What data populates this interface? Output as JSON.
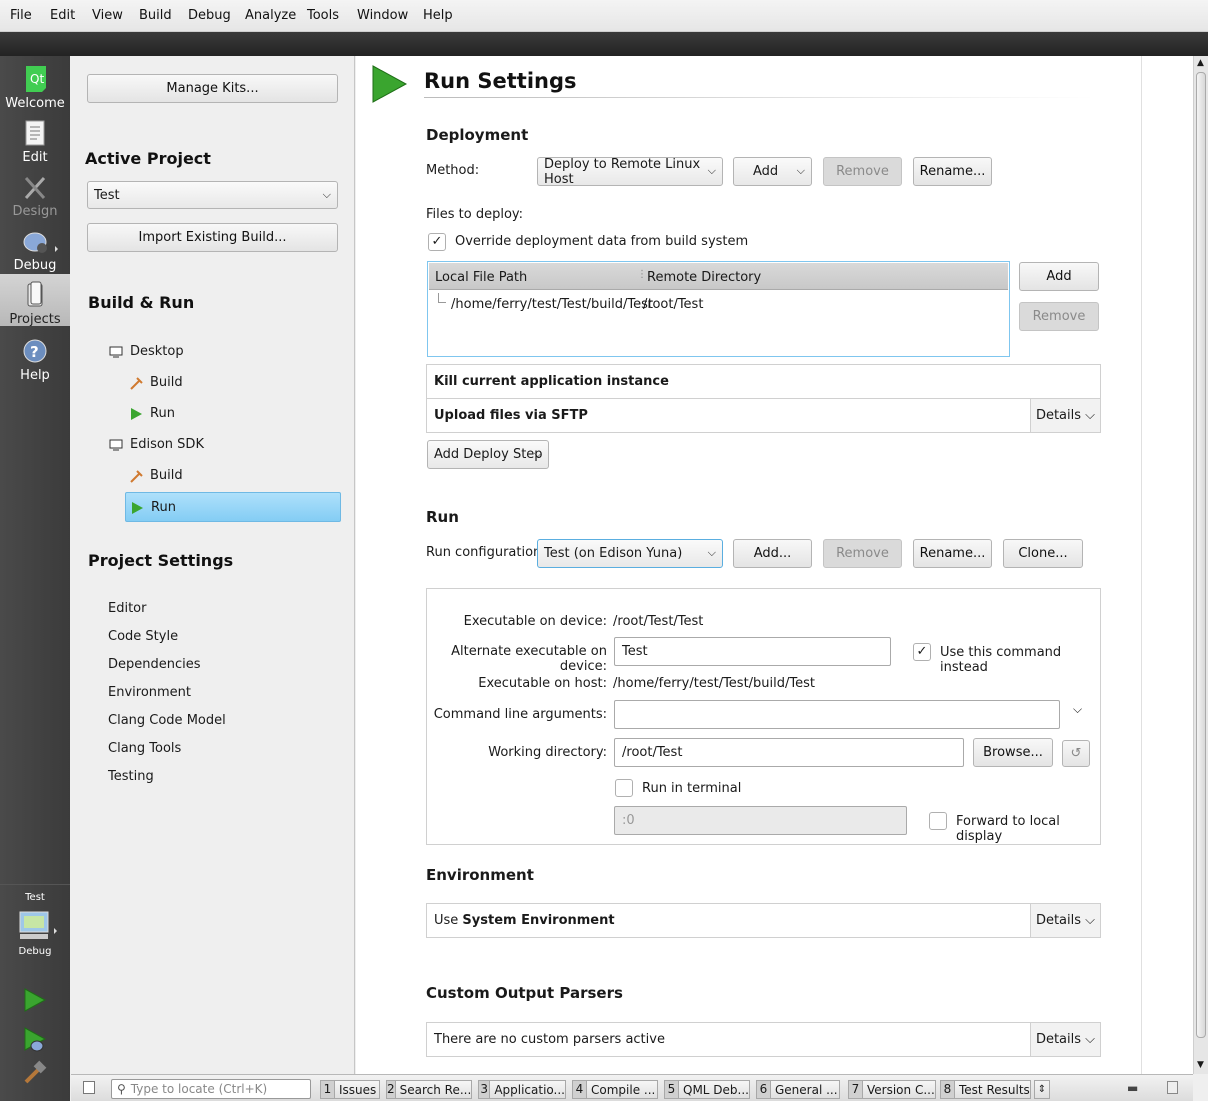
{
  "menu": [
    "File",
    "Edit",
    "View",
    "Build",
    "Debug",
    "Analyze",
    "Tools",
    "Window",
    "Help"
  ],
  "modes": {
    "welcome": "Welcome",
    "edit": "Edit",
    "design": "Design",
    "debug": "Debug",
    "projects": "Projects",
    "help": "Help",
    "kit_project": "Test",
    "kit_mode": "Debug"
  },
  "left": {
    "manage_kits": "Manage Kits...",
    "active_project_heading": "Active Project",
    "project": "Test",
    "import_build": "Import Existing Build...",
    "build_run_heading": "Build & Run",
    "tree": {
      "desktop": "Desktop",
      "desktop_build": "Build",
      "desktop_run": "Run",
      "edison": "Edison SDK",
      "edison_build": "Build",
      "edison_run": "Run"
    },
    "project_settings_heading": "Project Settings",
    "settings": [
      "Editor",
      "Code Style",
      "Dependencies",
      "Environment",
      "Clang Code Model",
      "Clang Tools",
      "Testing"
    ]
  },
  "main": {
    "title": "Run Settings",
    "deployment": {
      "heading": "Deployment",
      "method_label": "Method:",
      "method_value": "Deploy to Remote Linux Host",
      "add": "Add",
      "remove": "Remove",
      "rename": "Rename...",
      "files_label": "Files to deploy:",
      "override_label": "Override deployment data from build system",
      "col_local": "Local File Path",
      "col_remote": "Remote Directory",
      "file_local": "/home/ferry/test/Test/build/Test",
      "file_remote": "/root/Test",
      "files_add": "Add",
      "files_remove": "Remove",
      "step_kill": "Kill current application instance",
      "step_upload": "Upload files via SFTP",
      "details": "Details",
      "add_step": "Add Deploy Step"
    },
    "run": {
      "heading": "Run",
      "config_label": "Run configuration:",
      "config_value": "Test (on Edison Yuna)",
      "add": "Add...",
      "remove": "Remove",
      "rename": "Rename...",
      "clone": "Clone...",
      "exe_device_label": "Executable on device:",
      "exe_device_value": "/root/Test/Test",
      "alt_exe_label": "Alternate executable on device:",
      "alt_exe_value": "Test",
      "use_command_label": "Use this command instead",
      "exe_host_label": "Executable on host:",
      "exe_host_value": "/home/ferry/test/Test/build/Test",
      "args_label": "Command line arguments:",
      "args_value": "",
      "workdir_label": "Working directory:",
      "workdir_value": "/root/Test",
      "browse": "Browse...",
      "terminal_label": "Run in terminal",
      "display_value": ":0",
      "forward_label": "Forward to local display"
    },
    "environment": {
      "heading": "Environment",
      "prefix": "Use ",
      "value": "System Environment",
      "details": "Details"
    },
    "parsers": {
      "heading": "Custom Output Parsers",
      "text": "There are no custom parsers active",
      "details": "Details"
    }
  },
  "bottom": {
    "locate_placeholder": "Type to locate (Ctrl+K)",
    "tabs": [
      {
        "n": "1",
        "label": "Issues"
      },
      {
        "n": "2",
        "label": "Search Re..."
      },
      {
        "n": "3",
        "label": "Applicatio..."
      },
      {
        "n": "4",
        "label": "Compile ..."
      },
      {
        "n": "5",
        "label": "QML Deb..."
      },
      {
        "n": "6",
        "label": "General ..."
      },
      {
        "n": "7",
        "label": "Version C..."
      },
      {
        "n": "8",
        "label": "Test Results"
      }
    ]
  },
  "colors": {
    "accent": "#8fd0f5",
    "run_green": "#3aa52f",
    "sidebar": "#404040"
  }
}
